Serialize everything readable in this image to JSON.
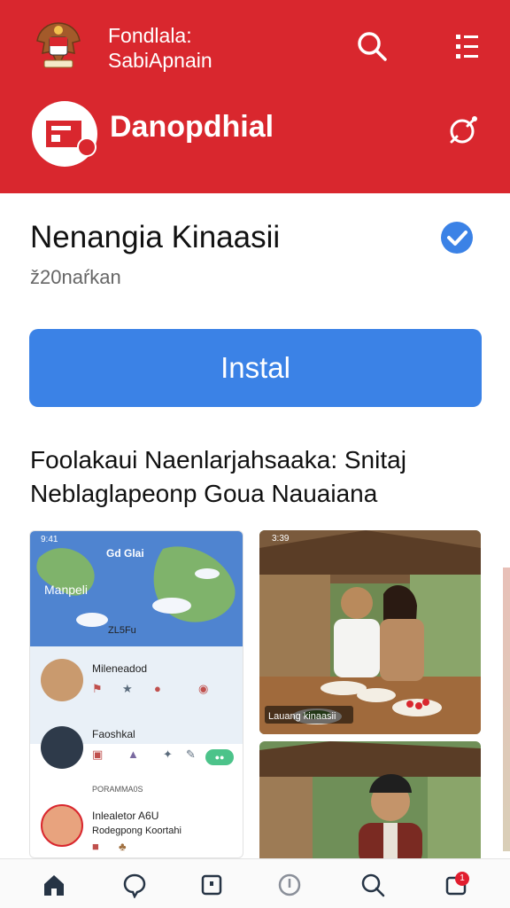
{
  "header": {
    "brand_line1": "Fondlala:",
    "brand_line2": "SabiApnain",
    "app_name": "Danopdhial",
    "icons": [
      "emblem-icon",
      "search-icon",
      "menu-icon",
      "app-logo-icon",
      "share-icon"
    ]
  },
  "app": {
    "title": "Nenangia Kinaasii",
    "subtitle": "ž20naŕkan",
    "install_label": "Instal",
    "description": "Foolakaui Naenlarjahsaaka: Snitaj Neblaglapeonp Goua Nauaiana"
  },
  "screenshot1": {
    "status": "9:41",
    "title": "Gd Glai",
    "map_label": "Manpeli",
    "map_number": "ZL5Fu",
    "item1_name": "Mileneadod",
    "item2_name": "Faoshkal",
    "section_label": "PORAMMA0S",
    "item3_name": "Inlealetor A6U",
    "item3_sub": "Rodegpong Koortahi",
    "pill_label": "●●"
  },
  "screenshot2": {
    "status": "3:39",
    "caption": "Lauang kinaasii"
  },
  "bottom_nav": {
    "icons": [
      "home-icon",
      "chat-icon",
      "square-icon",
      "shield-icon",
      "search-icon",
      "notification-icon"
    ],
    "badge": "1"
  },
  "colors": {
    "header_red": "#d9272e",
    "install_blue": "#3b82e6",
    "verified_blue": "#3b82e6"
  }
}
